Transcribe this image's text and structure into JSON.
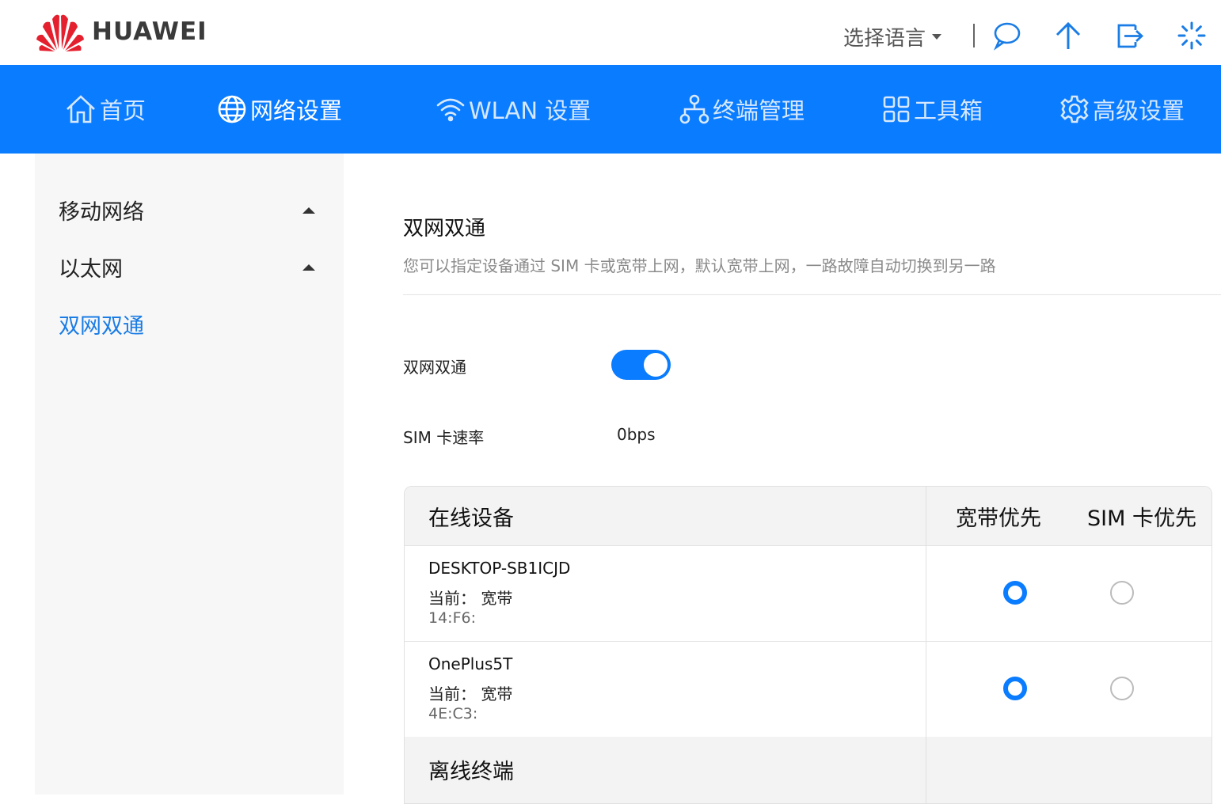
{
  "header": {
    "brand": "HUAWEI",
    "language_label": "选择语言",
    "icons": [
      "message-icon",
      "upgrade-icon",
      "logout-icon",
      "loading-icon"
    ]
  },
  "nav": {
    "items": [
      {
        "label": "首页",
        "icon": "home-icon"
      },
      {
        "label": "网络设置",
        "icon": "globe-icon"
      },
      {
        "label": "WLAN 设置",
        "icon": "wifi-icon"
      },
      {
        "label": "终端管理",
        "icon": "network-tree-icon"
      },
      {
        "label": "工具箱",
        "icon": "grid-icon"
      },
      {
        "label": "高级设置",
        "icon": "gear-icon"
      }
    ],
    "active_index": 1
  },
  "sidebar": {
    "items": [
      {
        "label": "移动网络"
      },
      {
        "label": "以太网"
      },
      {
        "label": "双网双通"
      }
    ],
    "active_index": 2
  },
  "main": {
    "title": "双网双通",
    "description": "您可以指定设备通过 SIM 卡或宽带上网，默认宽带上网，一路故障自动切换到另一路",
    "toggle_label": "双网双通",
    "toggle_on": true,
    "sim_rate_label": "SIM 卡速率",
    "sim_rate_value": "0bps"
  },
  "devices_table": {
    "headers": {
      "device": "在线设备",
      "broadband": "宽带优先",
      "sim": "SIM 卡优先"
    },
    "rows": [
      {
        "name": "DESKTOP-SB1ICJD",
        "current": "当前： 宽带",
        "mac": "14:F6:",
        "priority": "broadband"
      },
      {
        "name": "OnePlus5T",
        "current": "当前： 宽带",
        "mac": "4E:C3:",
        "priority": "broadband"
      }
    ],
    "offline_label": "离线终端"
  },
  "colors": {
    "accent": "#0a7cff",
    "brand_red": "#e5202e",
    "sidebar_bg": "#f7f7f7"
  }
}
